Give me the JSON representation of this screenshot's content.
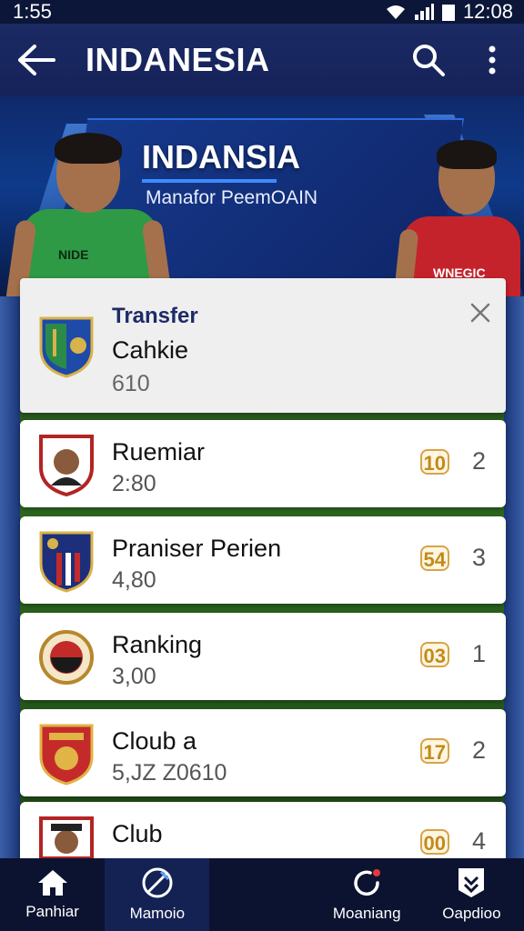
{
  "status_bar": {
    "time_left": "1:55",
    "time_right": "12:08"
  },
  "app_bar": {
    "title": "INDANESIA",
    "back_icon": "arrow-left-icon",
    "search_icon": "search-icon",
    "more_icon": "more-vertical-icon"
  },
  "hero": {
    "title": "INDANSIA",
    "subtitle": "Manafor PeemOAIN",
    "left_jersey_text": "NIDE",
    "right_jersey_text": "WNEGIC"
  },
  "header_card": {
    "kicker": "Transfer",
    "title": "Cahkie",
    "value": "610"
  },
  "rows": [
    {
      "title": "Ruemiar",
      "value": "2:80",
      "badge": "10",
      "rank": "2"
    },
    {
      "title": "Praniser Perien",
      "value": "4,80",
      "badge": "54",
      "rank": "3"
    },
    {
      "title": "Ranking",
      "value": "3,00",
      "badge": "03",
      "rank": "1"
    },
    {
      "title": "Cloub a",
      "value": "5,JZ Z0610",
      "badge": "17",
      "rank": "2"
    },
    {
      "title": "Club",
      "value": "",
      "badge": "00",
      "rank": "4"
    }
  ],
  "nav": [
    {
      "label": "Panhiar",
      "icon": "home-icon"
    },
    {
      "label": "Mamoio",
      "icon": "ball-icon"
    },
    {
      "label": "",
      "icon": ""
    },
    {
      "label": "Moaniang",
      "icon": "refresh-icon"
    },
    {
      "label": "Oapdioo",
      "icon": "shield-check-icon"
    }
  ],
  "colors": {
    "app_bar": "#1b2a63",
    "badge_gold": "#c28a1c",
    "nav_bg": "#0b1330"
  }
}
